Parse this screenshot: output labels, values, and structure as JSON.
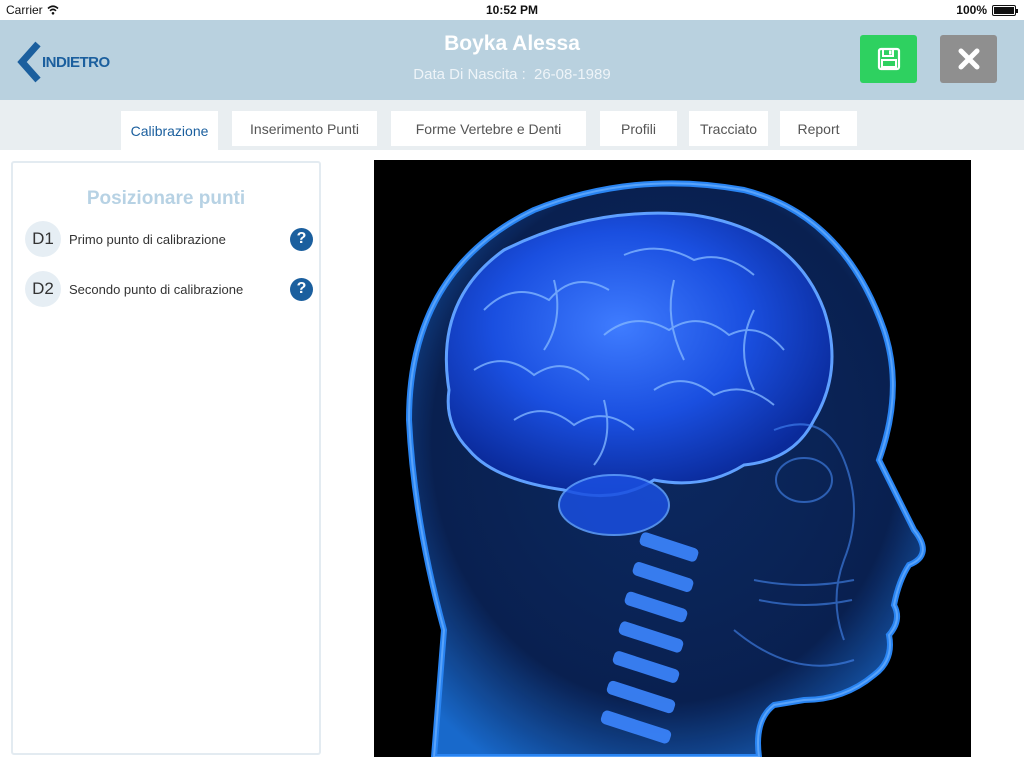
{
  "status_bar": {
    "carrier": "Carrier",
    "time": "10:52 PM",
    "battery": "100%",
    "battery_level": 1.0
  },
  "header": {
    "back_label": "INDIETRO",
    "patient_name": "Boyka  Alessa",
    "dob_label": "Data Di Nascita :",
    "dob_value": "26-08-1989"
  },
  "tabs": [
    {
      "label": "Calibrazione",
      "active": true
    },
    {
      "label": "Inserimento Punti"
    },
    {
      "label": "Forme Vertebre e Denti"
    },
    {
      "label": "Profili"
    },
    {
      "label": "Tracciato"
    },
    {
      "label": "Report"
    }
  ],
  "panel": {
    "title": "Posizionare punti",
    "points": [
      {
        "id": "D1",
        "label": "Primo punto di calibrazione"
      },
      {
        "id": "D2",
        "label": "Secondo punto di calibrazione"
      }
    ]
  },
  "image": {
    "subject": "x-ray-head-skull-brain"
  },
  "colors": {
    "accent": "#1b5f9e",
    "header_bg": "#b9d1df",
    "save": "#2ed160",
    "close": "#8f8f8f"
  }
}
